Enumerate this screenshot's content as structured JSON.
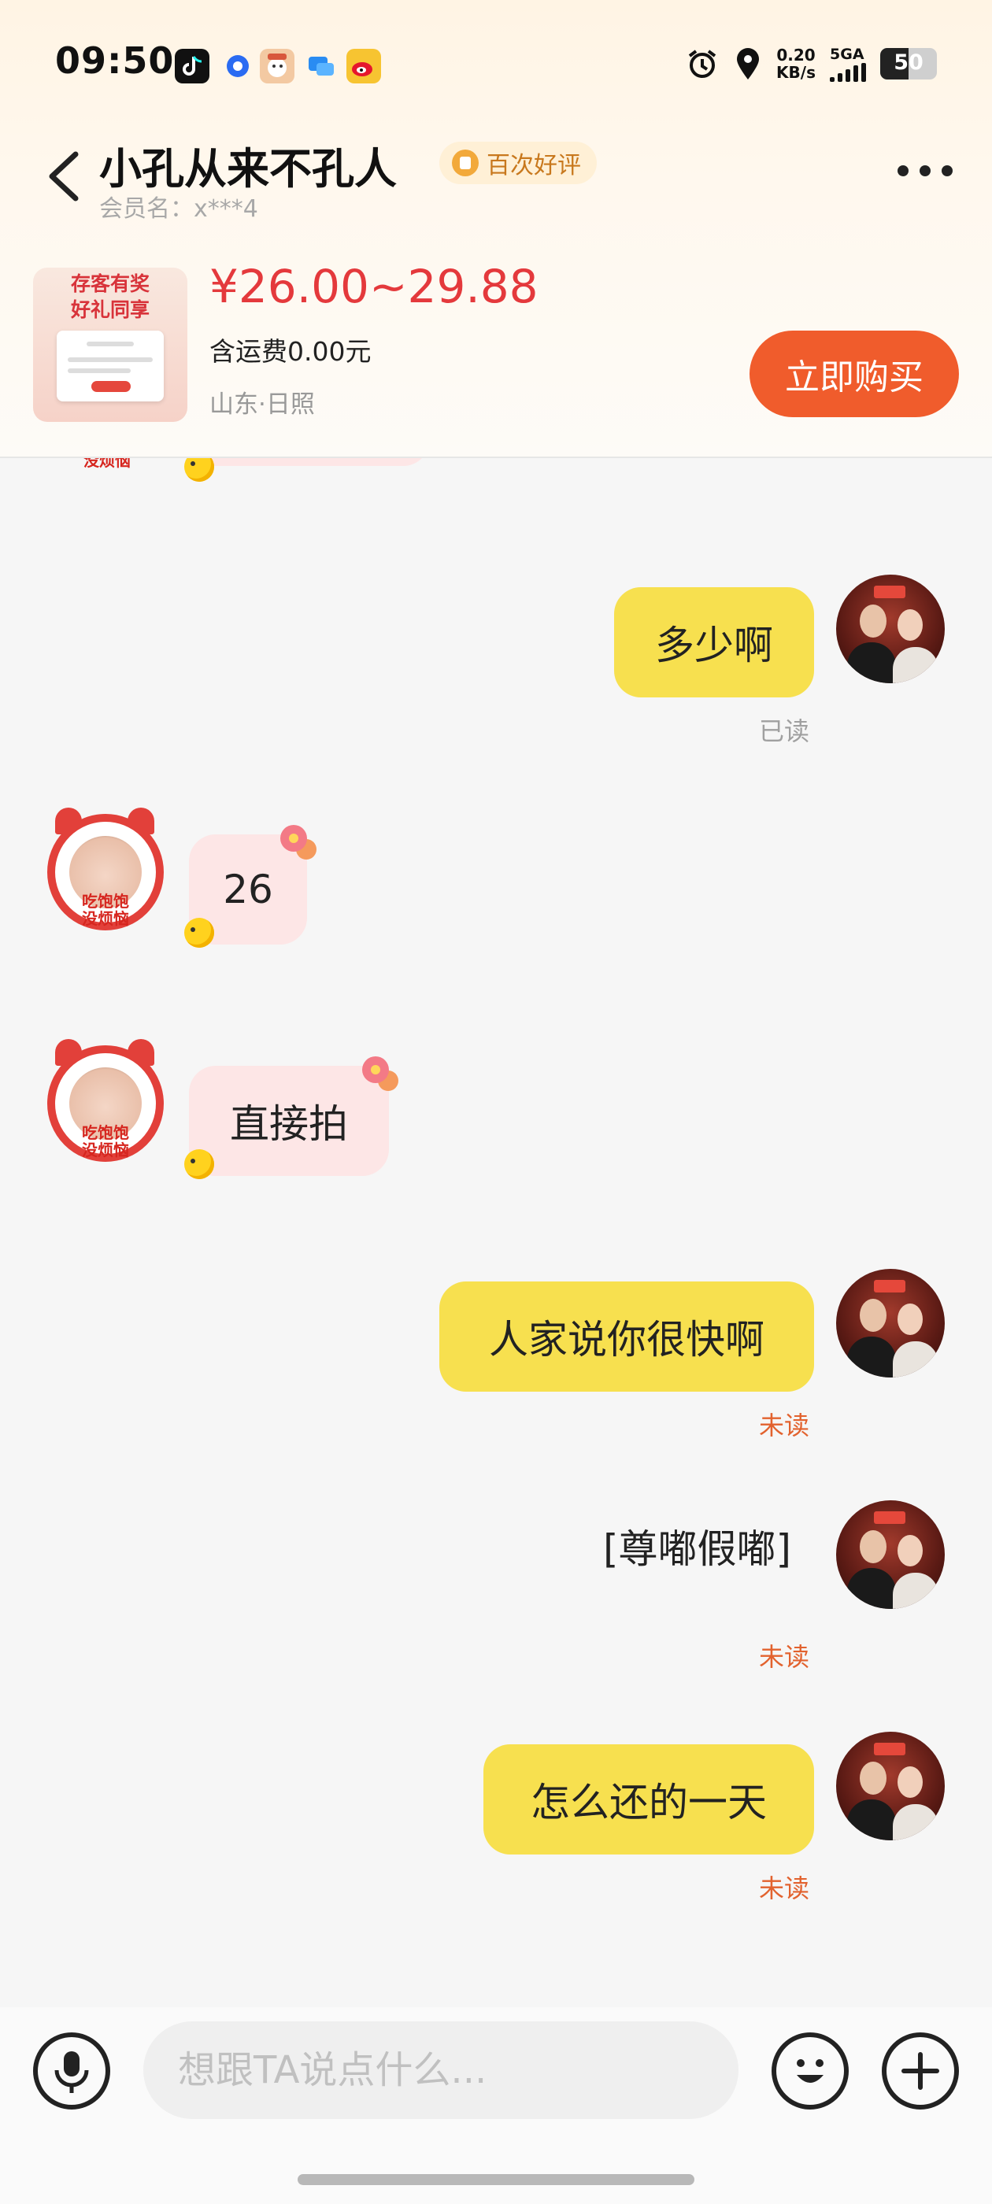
{
  "status_bar": {
    "time": "09:50",
    "net_speed_value": "0.20",
    "net_speed_unit": "KB/s",
    "network_type": "5GA",
    "battery": "50",
    "app_icons": [
      "douyin-icon",
      "browser-icon",
      "game-app-icon",
      "chat-app-icon",
      "weibo-icon"
    ]
  },
  "header": {
    "shop_name": "小孔从来不孔人",
    "badge": "百次好评",
    "member_name": "会员名：x***4"
  },
  "product": {
    "thumb_title": "存客有奖\n好礼同享",
    "price": "¥26.00~29.88",
    "shipping": "含运费0.00元",
    "location": "山东·日照",
    "buy_label": "立即购买"
  },
  "messages": {
    "m1": {
      "sender": "me",
      "text": "多少啊",
      "receipt": "已读"
    },
    "m2": {
      "sender": "shop",
      "text": "26"
    },
    "m3": {
      "sender": "shop",
      "text": "直接拍"
    },
    "m4": {
      "sender": "me",
      "text": "人家说你很快啊",
      "receipt": "未读"
    },
    "m5": {
      "sender": "me",
      "text": "[尊嘟假嘟]",
      "receipt": "未读"
    },
    "m6": {
      "sender": "me",
      "text": "怎么还的一天",
      "receipt": "未读"
    }
  },
  "shop_avatar_label": "吃饱饱\n没烦恼",
  "input": {
    "placeholder": "想跟TA说点什么..."
  },
  "colors": {
    "my_bubble": "#f7e04f",
    "shop_bubble": "#fde6e6",
    "price": "#e4393c",
    "buy_button": "#f05c2c",
    "unread": "#e2622e"
  }
}
